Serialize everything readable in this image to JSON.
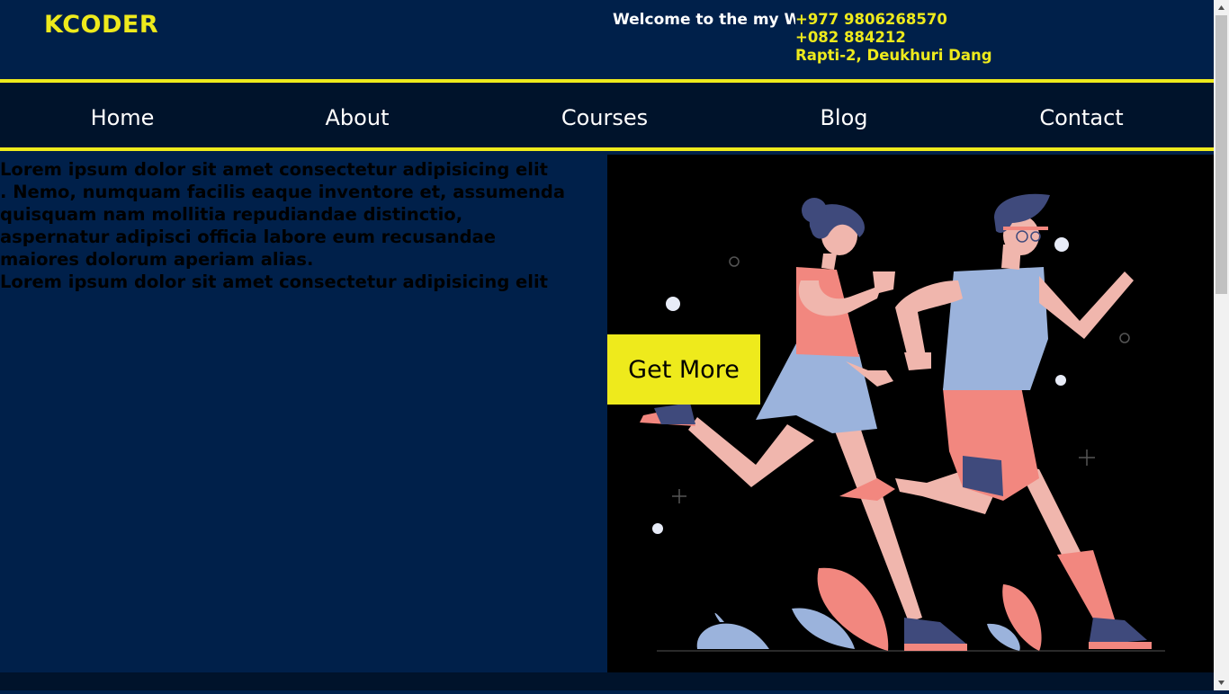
{
  "brand": {
    "name": "KCODER"
  },
  "header": {
    "welcome": "Welcome to the my Website",
    "phone1": "+977 9806268570",
    "phone2": "+082 884212",
    "address": "Rapti-2, Deukhuri Dang"
  },
  "nav": {
    "items": [
      {
        "label": "Home"
      },
      {
        "label": "About"
      },
      {
        "label": "Courses"
      },
      {
        "label": "Blog"
      },
      {
        "label": "Contact"
      }
    ]
  },
  "hero": {
    "line1": "Lorem ipsum dolor sit amet consectetur adipisicing elit",
    "line2": ". Nemo, numquam facilis eaque inventore et, assumenda",
    "line3": "quisquam nam mollitia repudiandae distinctio,",
    "line4": "aspernatur adipisci officia labore eum recusandae",
    "line5": "maiores dolorum aperiam alias.",
    "line6": "Lorem ipsum dolor sit amet consectetur adipisicing elit",
    "cta_label": "Get More",
    "illustration": "two-people-running-illustration"
  },
  "colors": {
    "header_bg": "#00204a",
    "nav_bg": "#00132b",
    "accent": "#eeea1c",
    "illustration_bg": "#000000"
  }
}
